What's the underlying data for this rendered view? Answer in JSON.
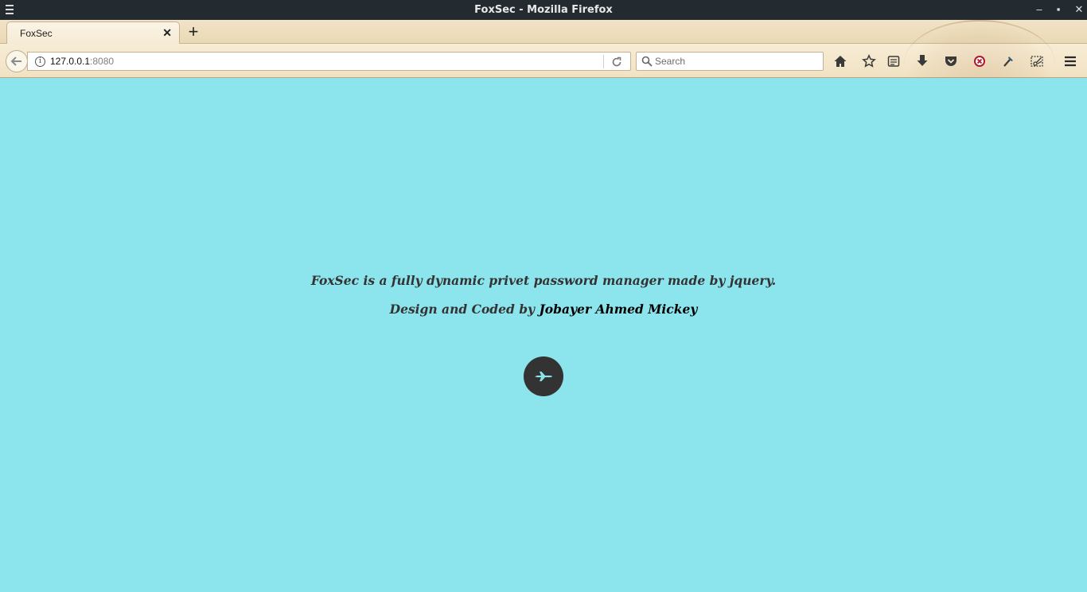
{
  "window": {
    "title": "FoxSec - Mozilla Firefox",
    "controls": {
      "minimize": "–",
      "maximize": "▪",
      "close": "✕"
    }
  },
  "tabs": [
    {
      "label": "FoxSec",
      "close": "✕"
    }
  ],
  "newtab_label": "+",
  "navbar": {
    "url_host": "127.0.0.1",
    "url_port": ":8080",
    "search_placeholder": "Search",
    "icons": [
      "back-icon",
      "site-info-icon",
      "reload-icon",
      "search-icon",
      "home-icon",
      "bookmark-star-icon",
      "reading-list-icon",
      "download-icon",
      "pocket-icon",
      "adblock-icon",
      "dropper-icon",
      "screenshot-icon",
      "hamburger-menu-icon"
    ]
  },
  "page": {
    "line1": "FoxSec is a fully dynamic privet password manager made by jquery.",
    "line2_prefix": "Design and Coded by ",
    "line2_author": "Jobayer Ahmed Mickey",
    "enter_icon": "plane-icon"
  },
  "colors": {
    "page_background": "#8ce4ec",
    "button_background": "#333333",
    "button_icon": "#8ce4ec",
    "titlebar": "#232a30"
  }
}
